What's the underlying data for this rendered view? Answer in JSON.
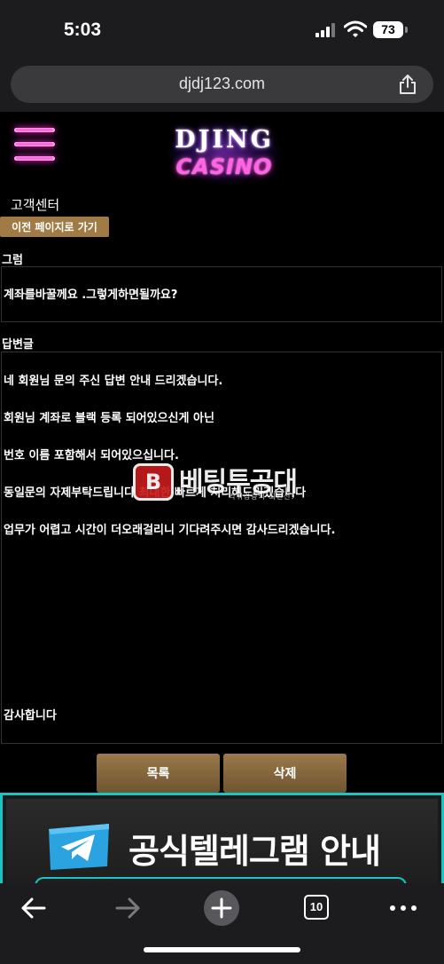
{
  "status_bar": {
    "time": "5:03",
    "battery": "73"
  },
  "browser": {
    "url": "djdj123.com"
  },
  "logo": {
    "line1": "DJING",
    "line2": "CASINO",
    "colors": {
      "top": "#ffffff",
      "bottom": "#ff64e6",
      "glow": "#b36bff"
    }
  },
  "page": {
    "section_title": "고객센터",
    "back_button": "이전 페이지로 가기",
    "question_label": "그럼",
    "question_text": "계좌를바꿀께요 .그렇게하면될까요?",
    "answer_label": "답변글",
    "answer_lines": [
      "네 회원님 문의 주신 답변 안내 드리겠습니다.",
      "회원님 계좌로 블랙 등록 되어있으신게 아닌",
      "번호 이름 포함해서 되어있으십니다.",
      "동일문의 자제부탁드립니다 최대한 빠르게 처리해드리겠습니다",
      "업무가 어렵고 시간이 더오래걸리니 기다려주시면 감사드리겠습니다."
    ],
    "closing": "감사합니다",
    "list_button": "목록",
    "delete_button": "삭제"
  },
  "watermark": {
    "badge": "B",
    "title": "베팅투공대",
    "subtitle": "먹튀검증의 최전선!"
  },
  "banner": {
    "text": "공식텔레그램 안내",
    "accent": "#19c4c4"
  },
  "toolbar": {
    "tabs_count": "10"
  }
}
